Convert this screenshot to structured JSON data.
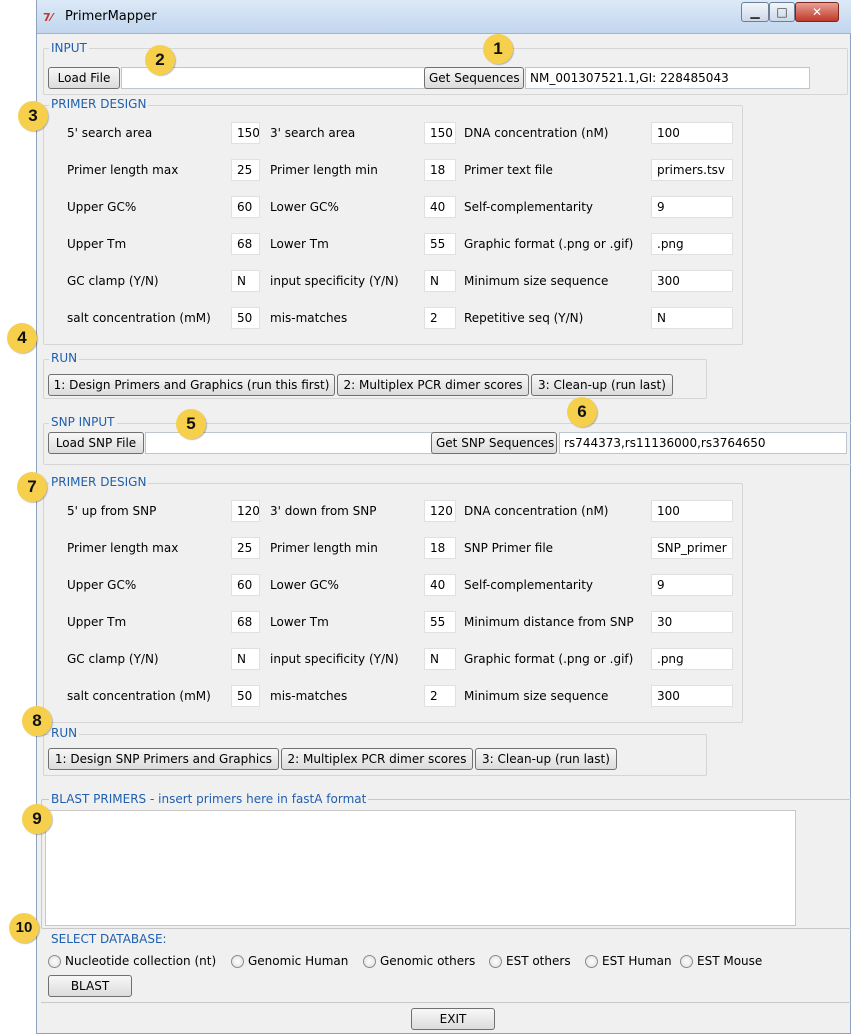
{
  "window": {
    "title": "PrimerMapper",
    "icon": "tk-feather-icon",
    "minimize": "▁",
    "maximize": "□",
    "close": "✕"
  },
  "badges": [
    "1",
    "2",
    "3",
    "4",
    "5",
    "6",
    "7",
    "8",
    "9",
    "10"
  ],
  "input": {
    "label": "INPUT",
    "load_button": "Load File",
    "file_path": "",
    "get_button": "Get Sequences",
    "accession": "NM_001307521.1,GI: 228485043"
  },
  "primer_design": {
    "label": "PRIMER DESIGN",
    "rows": [
      [
        {
          "label": "5' search area",
          "value": "150"
        },
        {
          "label": "3' search area",
          "value": "150"
        },
        {
          "label": "DNA concentration (nM)",
          "value": "100"
        }
      ],
      [
        {
          "label": "Primer length max",
          "value": "25"
        },
        {
          "label": "Primer length min",
          "value": "18"
        },
        {
          "label": "Primer text file",
          "value": "primers.tsv"
        }
      ],
      [
        {
          "label": "Upper GC%",
          "value": "60"
        },
        {
          "label": "Lower GC%",
          "value": "40"
        },
        {
          "label": "Self-complementarity",
          "value": "9"
        }
      ],
      [
        {
          "label": "Upper Tm",
          "value": "68"
        },
        {
          "label": "Lower Tm",
          "value": "55"
        },
        {
          "label": "Graphic format (.png or .gif)",
          "value": ".png"
        }
      ],
      [
        {
          "label": "GC clamp (Y/N)",
          "value": "N"
        },
        {
          "label": "input specificity (Y/N)",
          "value": "N"
        },
        {
          "label": "Minimum size sequence",
          "value": "300"
        }
      ],
      [
        {
          "label": "salt concentration (mM)",
          "value": "50"
        },
        {
          "label": "mis-matches",
          "value": "2"
        },
        {
          "label": "Repetitive seq (Y/N)",
          "value": "N"
        }
      ]
    ]
  },
  "run": {
    "label": "RUN",
    "buttons": [
      "1: Design Primers and Graphics (run this first)",
      "2: Multiplex PCR dimer scores",
      "3: Clean-up (run last)"
    ]
  },
  "snp_input": {
    "label": "SNP INPUT",
    "load_button": "Load SNP File",
    "file_path": "",
    "get_button": "Get SNP Sequences",
    "ids": "rs744373,rs11136000,rs3764650"
  },
  "snp_primer_design": {
    "label": "PRIMER DESIGN",
    "rows": [
      [
        {
          "label": "5' up from SNP",
          "value": "120"
        },
        {
          "label": "3' down from SNP",
          "value": "120"
        },
        {
          "label": "DNA concentration (nM)",
          "value": "100"
        }
      ],
      [
        {
          "label": "Primer length max",
          "value": "25"
        },
        {
          "label": "Primer length min",
          "value": "18"
        },
        {
          "label": "SNP Primer file",
          "value": "SNP_primer"
        }
      ],
      [
        {
          "label": "Upper GC%",
          "value": "60"
        },
        {
          "label": "Lower GC%",
          "value": "40"
        },
        {
          "label": "Self-complementarity",
          "value": "9"
        }
      ],
      [
        {
          "label": "Upper Tm",
          "value": "68"
        },
        {
          "label": "Lower Tm",
          "value": "55"
        },
        {
          "label": "Minimum distance from SNP",
          "value": "30"
        }
      ],
      [
        {
          "label": "GC clamp (Y/N)",
          "value": "N"
        },
        {
          "label": "input specificity (Y/N)",
          "value": "N"
        },
        {
          "label": "Graphic format (.png or .gif)",
          "value": ".png"
        }
      ],
      [
        {
          "label": "salt concentration (mM)",
          "value": "50"
        },
        {
          "label": "mis-matches",
          "value": "2"
        },
        {
          "label": "Minimum size sequence",
          "value": "300"
        }
      ]
    ]
  },
  "snp_run": {
    "label": "RUN",
    "buttons": [
      "1: Design SNP Primers and Graphics",
      "2: Multiplex PCR dimer scores",
      "3: Clean-up (run last)"
    ]
  },
  "blast": {
    "label": "BLAST PRIMERS - insert primers here in fastA format",
    "content": ""
  },
  "database": {
    "label": "SELECT DATABASE:",
    "options": [
      "Nucleotide collection (nt)",
      "Genomic Human",
      "Genomic others",
      "EST others",
      "EST Human",
      "EST Mouse"
    ],
    "blast_button": "BLAST"
  },
  "exit_button": "EXIT"
}
